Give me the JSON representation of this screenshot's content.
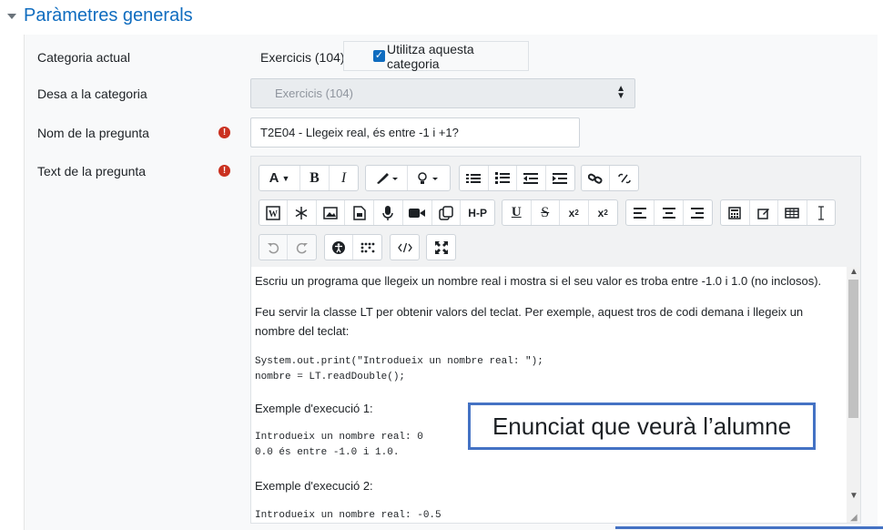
{
  "section": {
    "title": "Paràmetres generals"
  },
  "fields": {
    "current_category": {
      "label": "Categoria actual",
      "value": "Exercicis (104)",
      "checkbox_label": "Utilitza aquesta categoria"
    },
    "save_category": {
      "label": "Desa a la categoria",
      "value": "Exercicis (104)"
    },
    "question_name": {
      "label": "Nom de la pregunta",
      "value": "T2E04 - Llegeix real, és entre -1 i +1?"
    },
    "question_text": {
      "label": "Text de la pregunta"
    }
  },
  "toolbar": {
    "font_btn": "A",
    "bold": "B",
    "italic": "I",
    "h5p": "H-P",
    "underline": "U",
    "strike": "S"
  },
  "editor_content": {
    "p1": "Escriu un programa que llegeix un nombre real i mostra si el seu valor es troba entre -1.0 i 1.0 (no inclosos).",
    "p2": "Feu servir la classe LT per obtenir valors del teclat. Per exemple, aquest tros de codi demana i llegeix un nombre del teclat:",
    "code1": "System.out.print(\"Introdueix un nombre real: \");",
    "code2": "nombre = LT.readDouble();",
    "example1_title": "Exemple d'execució 1:",
    "example1_line1": "Introdueix un nombre real: 0",
    "example1_line2": "0.0 és entre -1.0 i 1.0.",
    "example2_title": "Exemple d'execució 2:",
    "example2_line1": "Introdueix un nombre real: -0.5"
  },
  "annotation": {
    "text": "Enunciat que veurà l’alumne"
  },
  "colors": {
    "accent": "#0f6cbf",
    "required": "#ca3120",
    "annotation_border": "#4472c4"
  }
}
